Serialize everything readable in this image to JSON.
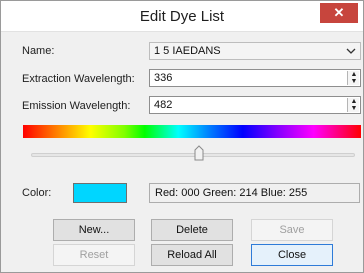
{
  "window": {
    "title": "Edit Dye List",
    "close_glyph": "✕"
  },
  "form": {
    "name_label": "Name:",
    "name_value": "1 5 IAEDANS",
    "extraction_label": "Extraction Wavelength:",
    "extraction_value": "336",
    "emission_label": "Emission Wavelength:",
    "emission_value": "482",
    "color_label": "Color:",
    "color_hex": "#00D6FF",
    "rgb_text": "Red: 000 Green: 214 Blue: 255"
  },
  "slider": {
    "level_fraction": 0.5
  },
  "buttons": {
    "new": "New...",
    "delete": "Delete",
    "save": "Save",
    "reset": "Reset",
    "reload_all": "Reload All",
    "close": "Close"
  },
  "icons": {
    "dropdown": "chevron-down-icon",
    "spin_up": "spin-up-icon",
    "spin_down": "spin-down-icon",
    "close": "close-icon"
  }
}
